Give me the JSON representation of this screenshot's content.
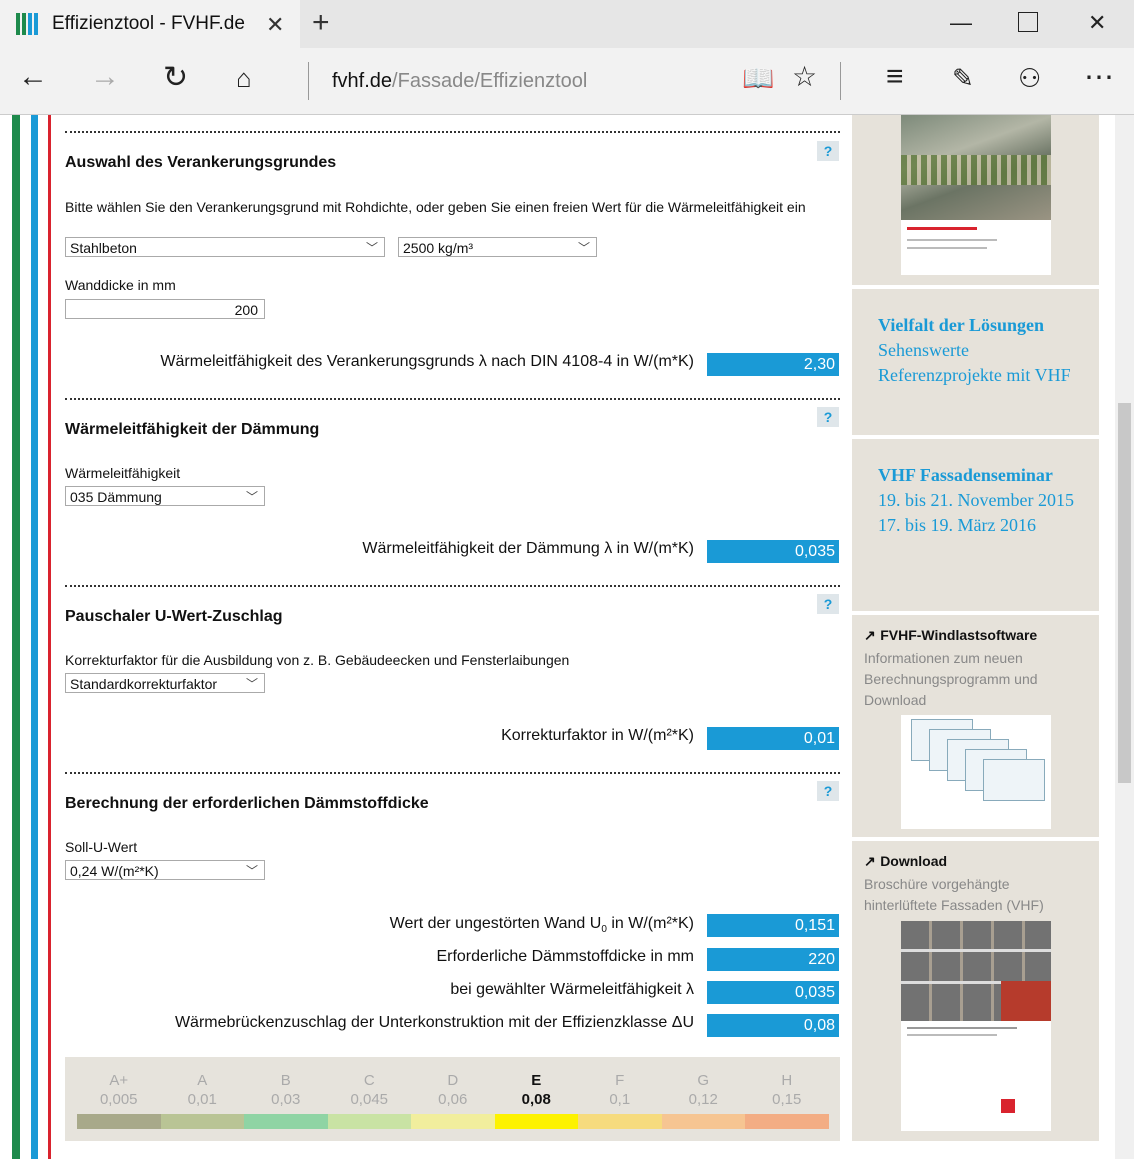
{
  "browser": {
    "tab_title": "Effizienztool - FVHF.de",
    "address_host": "fvhf.de",
    "address_path": "/Fassade/Effizienztool"
  },
  "section1": {
    "heading": "Auswahl des Verankerungsgrundes",
    "help": "?",
    "instruction": "Bitte wählen Sie den Verankerungsgrund mit Rohdichte, oder geben Sie einen freien Wert für die Wärmeleitfähigkeit ein",
    "material_select": "Stahlbeton",
    "density_select": "2500 kg/m³",
    "wall_label": "Wanddicke in mm",
    "wall_value": "200",
    "result_label": "Wärmeleitfähigkeit des Verankerungsgrunds λ nach DIN 4108-4 in W/(m*K)",
    "result_value": "2,30"
  },
  "section2": {
    "heading": "Wärmeleitfähigkeit der Dämmung",
    "help": "?",
    "field_label": "Wärmeleitfähigkeit",
    "select": "035 Dämmung",
    "result_label": "Wärmeleitfähigkeit der Dämmung λ in W/(m*K)",
    "result_value": "0,035"
  },
  "section3": {
    "heading": "Pauschaler U-Wert-Zuschlag",
    "help": "?",
    "field_label": "Korrekturfaktor für die Ausbildung von z. B. Gebäudeecken und Fensterlaibungen",
    "select": "Standardkorrekturfaktor",
    "result_label": "Korrekturfaktor in W/(m²*K)",
    "result_value": "0,01"
  },
  "section4": {
    "heading": "Berechnung der erforderlichen Dämmstoffdicke",
    "help": "?",
    "field_label": "Soll-U-Wert",
    "select": "0,24 W/(m²*K)",
    "results": [
      {
        "label_pre": "Wert der ungestörten Wand U",
        "label_sub": "0",
        "label_post": " in W/(m²*K)",
        "value": "0,151"
      },
      {
        "label_pre": "Erforderliche Dämmstoffdicke in mm",
        "label_sub": "",
        "label_post": "",
        "value": "220"
      },
      {
        "label_pre": "bei gewählter Wärmeleitfähigkeit λ",
        "label_sub": "",
        "label_post": "",
        "value": "0,035"
      },
      {
        "label_pre": "Wärmebrückenzuschlag der Unterkonstruktion mit der Effizienzklasse ΔU",
        "label_sub": "",
        "label_post": "",
        "value": "0,08"
      }
    ]
  },
  "efficiency": {
    "active_index": 5,
    "classes": [
      {
        "name": "A+",
        "value": "0,005",
        "color": "#a8a98a"
      },
      {
        "name": "A",
        "value": "0,01",
        "color": "#b9c495"
      },
      {
        "name": "B",
        "value": "0,03",
        "color": "#8fd4a4"
      },
      {
        "name": "C",
        "value": "0,045",
        "color": "#c9e3a4"
      },
      {
        "name": "D",
        "value": "0,06",
        "color": "#f1ee9d"
      },
      {
        "name": "E",
        "value": "0,08",
        "color": "#fdf200"
      },
      {
        "name": "F",
        "value": "0,1",
        "color": "#f6db7e"
      },
      {
        "name": "G",
        "value": "0,12",
        "color": "#f6c592"
      },
      {
        "name": "H",
        "value": "0,15",
        "color": "#f3ad84"
      }
    ]
  },
  "sidebar": {
    "promo1_title": "Vielfalt der Lösungen",
    "promo1_text": "Sehenswerte Referenzprojekte mit VHF",
    "promo2_title": "VHF Fassadenseminar",
    "promo2_line1": "19. bis 21. November 2015",
    "promo2_line2": "17. bis 19. März 2016",
    "link1_title": "FVHF-Windlastsoftware",
    "link1_text": "Informationen zum neuen Berechnungsprogramm und Download",
    "link2_title": "Download",
    "link2_text": "Broschüre vorgehängte hinterlüftete Fassaden (VHF)"
  },
  "colors": {
    "accent": "#1a9ad6",
    "sidebar_bg": "#e6e2da",
    "stripe_green": "#1e8a4c",
    "stripe_blue": "#1a9ad6",
    "stripe_red": "#d9232e"
  }
}
